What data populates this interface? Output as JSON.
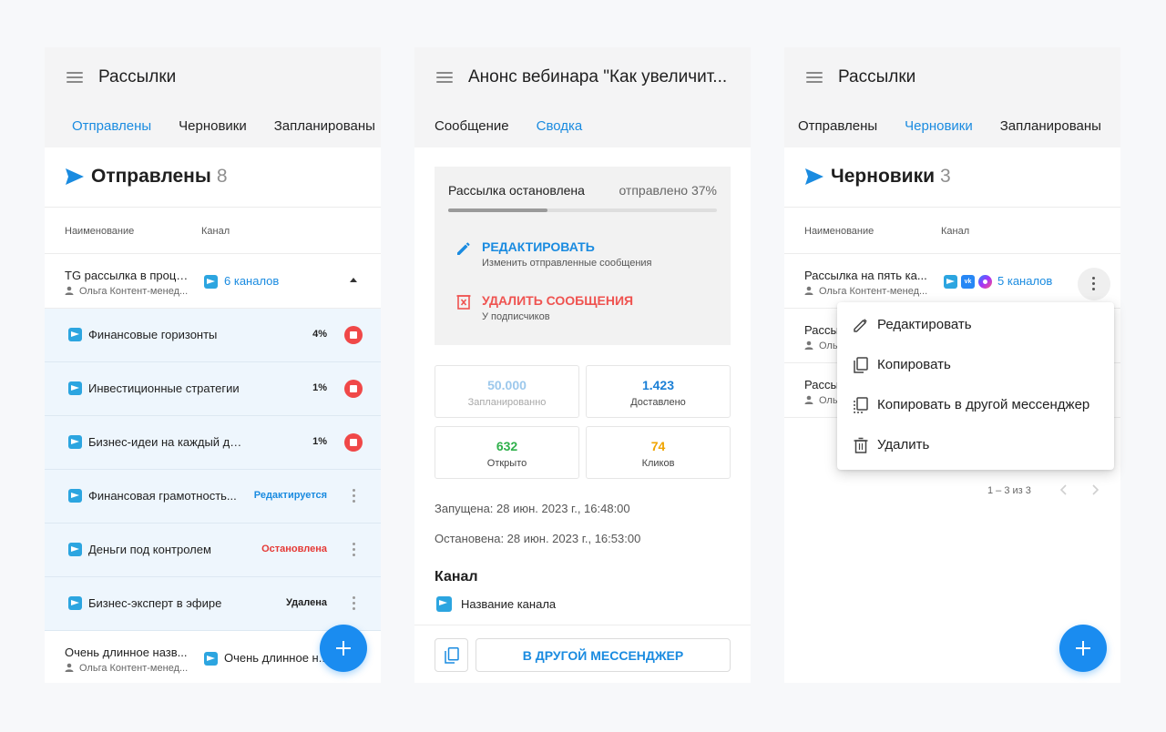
{
  "panel1": {
    "title": "Рассылки",
    "tabs": [
      "Отправлены",
      "Черновики",
      "Запланированы"
    ],
    "section_title": "Отправлены",
    "section_count": "8",
    "col_name": "Наименование",
    "col_channel": "Канал",
    "main_row": {
      "title": "TG рассылка в проце...",
      "author": "Ольга Контент-менед...",
      "channels": "6 каналов"
    },
    "sub_rows": [
      {
        "name": "Финансовые горизонты",
        "pct": "4%"
      },
      {
        "name": "Инвестиционные стратегии",
        "pct": "1%"
      },
      {
        "name": "Бизнес-идеи на каждый день",
        "pct": "1%"
      },
      {
        "name": "Финансовая грамотность...",
        "status": "Редактируется",
        "status_color": "#1a8be0"
      },
      {
        "name": "Деньги под контролем",
        "status": "Остановлена",
        "status_color": "#e53935"
      },
      {
        "name": "Бизнес-эксперт в эфире",
        "status": "Удалена",
        "status_color": "#1f1f1f"
      }
    ],
    "last_row": {
      "title": "Очень длинное назв...",
      "author": "Ольга Контент-менед...",
      "channel": "Очень длинное н..."
    }
  },
  "panel2": {
    "title": "Анонс вебинара \"Как увеличит...",
    "tabs": [
      "Сообщение",
      "Сводка"
    ],
    "status_label": "Рассылка остановлена",
    "sent_label": "отправлено 37%",
    "progress": 0.37,
    "edit_title": "РЕДАКТИРОВАТЬ",
    "edit_sub": "Изменить отправленные сообщения",
    "delete_title": "УДАЛИТЬ СООБЩЕНИЯ",
    "delete_sub": "У подписчиков",
    "stats": [
      {
        "value": "50.000",
        "label": "Запланированно",
        "color": "#9cc8ec",
        "label_color": "#a8a8a8"
      },
      {
        "value": "1.423",
        "label": "Доставлено",
        "color": "#1a7fd6",
        "label_color": "#444"
      },
      {
        "value": "632",
        "label": "Открыто",
        "color": "#2fb04b",
        "label_color": "#444"
      },
      {
        "value": "74",
        "label": "Кликов",
        "color": "#f0a400",
        "label_color": "#444"
      }
    ],
    "launched": "Запущена: 28 июн. 2023 г., 16:48:00",
    "stopped": "Остановена: 28 июн. 2023 г., 16:53:00",
    "channel_heading": "Канал",
    "channel_name": "Название канала",
    "other_button": "В ДРУГОЙ МЕССЕНДЖЕР"
  },
  "panel3": {
    "title": "Рассылки",
    "tabs": [
      "Отправлены",
      "Черновики",
      "Запланированы"
    ],
    "section_title": "Черновики",
    "section_count": "3",
    "col_name": "Наименование",
    "col_channel": "Канал",
    "main_row": {
      "title": "Рассылка на пять ка...",
      "author": "Ольга Контент-менед...",
      "channels": "5 каналов"
    },
    "row2": {
      "title": "Рассы",
      "author": "Ольг"
    },
    "row3": {
      "title": "Рассы",
      "author": "Ольг"
    },
    "pager": "1 – 3 из 3",
    "menu": [
      "Редактировать",
      "Копировать",
      "Копировать в другой мессенджер",
      "Удалить"
    ]
  },
  "colors": {
    "accent": "#1a8be0",
    "danger": "#f04848",
    "fab": "#1a8cf0"
  }
}
